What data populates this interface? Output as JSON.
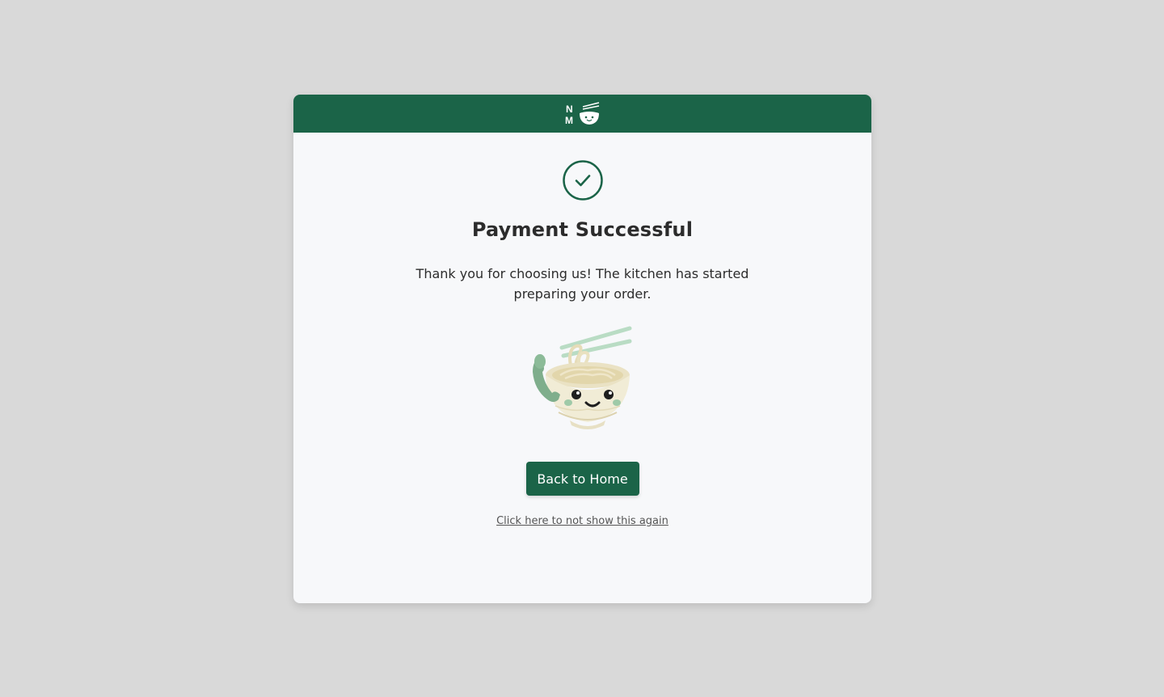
{
  "header": {
    "logo_letters": [
      "N",
      "M"
    ],
    "logo_icon": "noodle-bowl-icon"
  },
  "status": {
    "icon": "check-circle-icon",
    "title": "Payment Successful",
    "message": "Thank you for choosing us! The kitchen has started preparing your order."
  },
  "mascot": {
    "icon": "noodle-bowl-mascot-with-phone"
  },
  "actions": {
    "home_label": "Back to Home",
    "dont_show_label": "Click here to not show this again"
  },
  "colors": {
    "brand": "#1b6448",
    "background": "#d9d9d9",
    "card": "#f7f8fa",
    "text": "#2c2c2c"
  }
}
